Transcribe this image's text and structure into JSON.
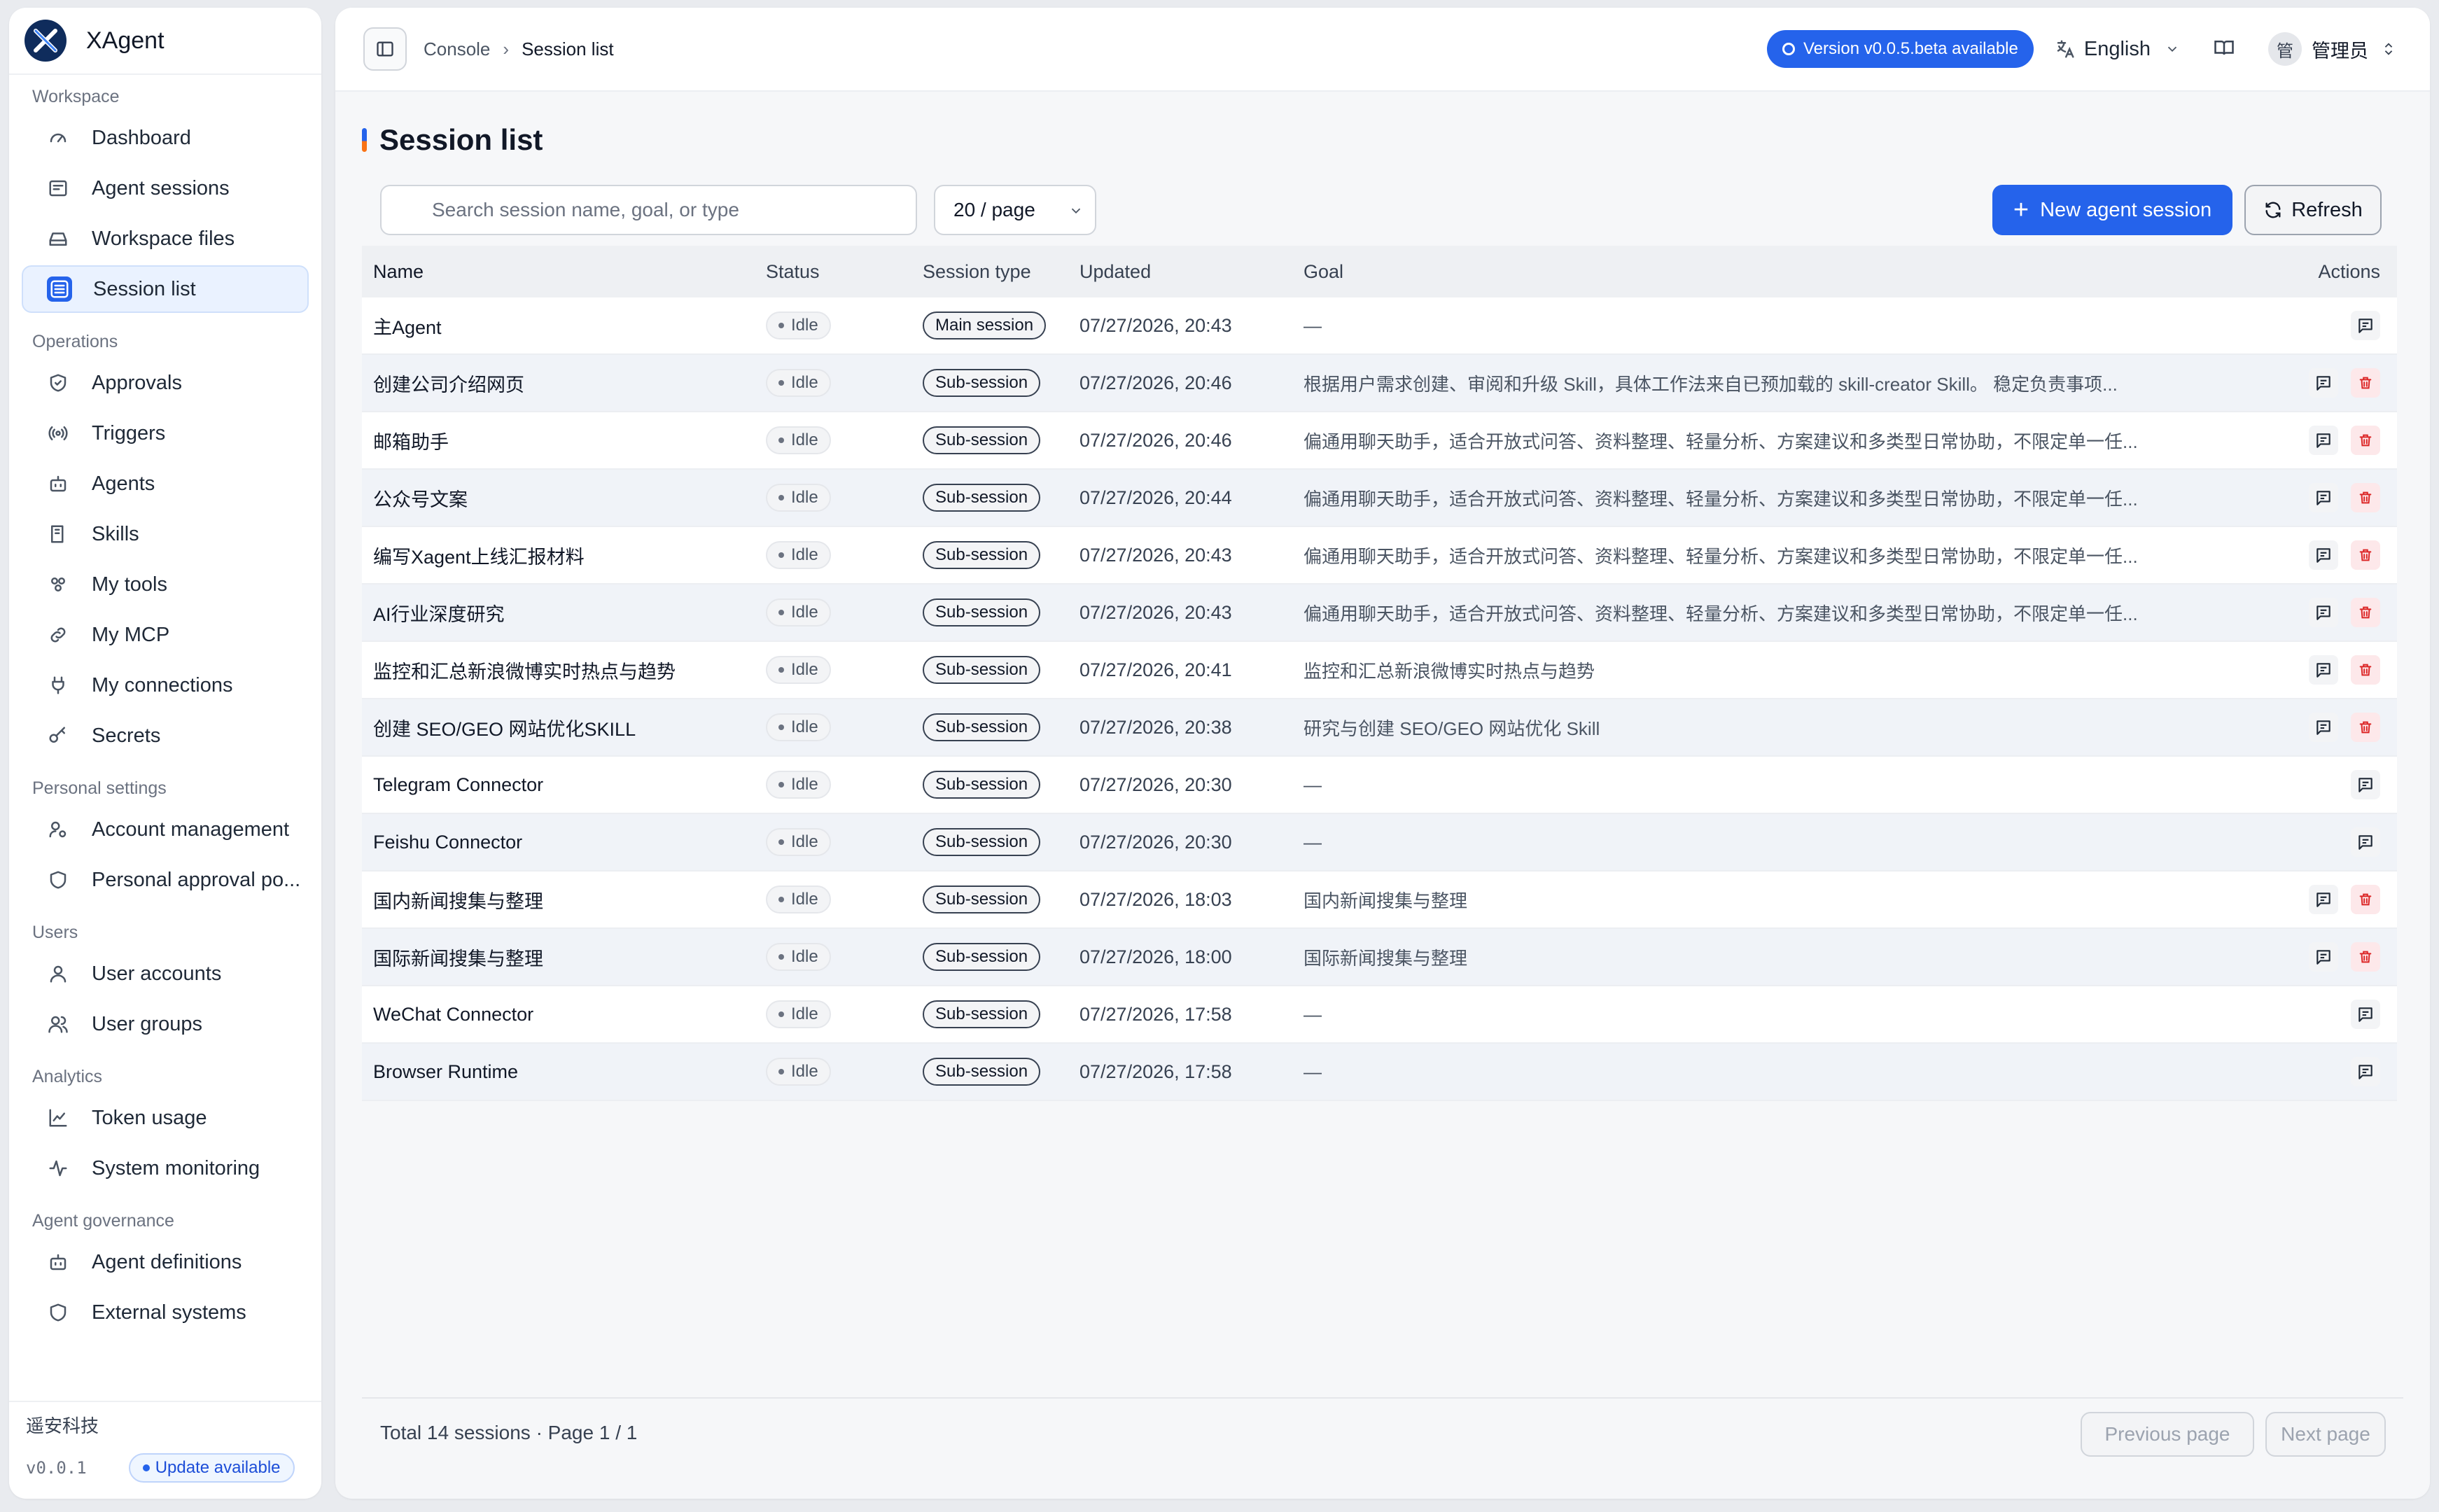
{
  "brand": {
    "name": "XAgent"
  },
  "sidebar": {
    "groups": [
      {
        "label": "Workspace",
        "items": [
          {
            "label": "Dashboard",
            "icon": "gauge-icon"
          },
          {
            "label": "Agent sessions",
            "icon": "message-square-icon"
          },
          {
            "label": "Workspace files",
            "icon": "hard-drive-icon"
          },
          {
            "label": "Session list",
            "icon": "list-icon",
            "active": true
          }
        ]
      },
      {
        "label": "Operations",
        "items": [
          {
            "label": "Approvals",
            "icon": "shield-check-icon"
          },
          {
            "label": "Triggers",
            "icon": "radio-icon"
          },
          {
            "label": "Agents",
            "icon": "bot-icon"
          },
          {
            "label": "Skills",
            "icon": "book-icon"
          },
          {
            "label": "My tools",
            "icon": "blocks-icon"
          },
          {
            "label": "My MCP",
            "icon": "link-icon"
          },
          {
            "label": "My connections",
            "icon": "plug-icon"
          },
          {
            "label": "Secrets",
            "icon": "key-icon"
          }
        ]
      },
      {
        "label": "Personal settings",
        "items": [
          {
            "label": "Account management",
            "icon": "user-cog-icon"
          },
          {
            "label": "Personal approval po...",
            "icon": "shield-icon"
          }
        ]
      },
      {
        "label": "Users",
        "items": [
          {
            "label": "User accounts",
            "icon": "user-icon"
          },
          {
            "label": "User groups",
            "icon": "users-icon"
          }
        ]
      },
      {
        "label": "Analytics",
        "items": [
          {
            "label": "Token usage",
            "icon": "line-chart-icon"
          },
          {
            "label": "System monitoring",
            "icon": "activity-icon"
          }
        ]
      },
      {
        "label": "Agent governance",
        "items": [
          {
            "label": "Agent definitions",
            "icon": "bot-icon"
          },
          {
            "label": "External systems",
            "icon": "shield-icon"
          }
        ]
      }
    ],
    "footer": {
      "org": "遥安科技",
      "version": "v0.0.1",
      "update_label": "Update available"
    }
  },
  "topbar": {
    "breadcrumb": [
      "Console",
      "Session list"
    ],
    "version_label": "Version v0.0.5.beta available",
    "language": "English",
    "avatar_text": "管",
    "user_name": "管理员"
  },
  "page": {
    "title": "Session list",
    "search_placeholder": "Search session name, goal, or type",
    "page_size": "20 / page",
    "new_button": "New agent session",
    "refresh_button": "Refresh"
  },
  "table": {
    "columns": [
      "Name",
      "Status",
      "Session type",
      "Updated",
      "Goal",
      "Actions"
    ],
    "rows": [
      {
        "name": "主Agent",
        "status": "Idle",
        "type": "Main session",
        "updated": "07/27/2026, 20:43",
        "goal": "—",
        "deletable": false
      },
      {
        "name": "创建公司介绍网页",
        "status": "Idle",
        "type": "Sub-session",
        "updated": "07/27/2026, 20:46",
        "goal": "根据用户需求创建、审阅和升级 Skill，具体工作法来自已预加载的 skill-creator Skill。 稳定负责事项...",
        "deletable": true
      },
      {
        "name": "邮箱助手",
        "status": "Idle",
        "type": "Sub-session",
        "updated": "07/27/2026, 20:46",
        "goal": "偏通用聊天助手，适合开放式问答、资料整理、轻量分析、方案建议和多类型日常协助，不限定单一任...",
        "deletable": true
      },
      {
        "name": "公众号文案",
        "status": "Idle",
        "type": "Sub-session",
        "updated": "07/27/2026, 20:44",
        "goal": "偏通用聊天助手，适合开放式问答、资料整理、轻量分析、方案建议和多类型日常协助，不限定单一任...",
        "deletable": true
      },
      {
        "name": "编写Xagent上线汇报材料",
        "status": "Idle",
        "type": "Sub-session",
        "updated": "07/27/2026, 20:43",
        "goal": "偏通用聊天助手，适合开放式问答、资料整理、轻量分析、方案建议和多类型日常协助，不限定单一任...",
        "deletable": true
      },
      {
        "name": "AI行业深度研究",
        "status": "Idle",
        "type": "Sub-session",
        "updated": "07/27/2026, 20:43",
        "goal": "偏通用聊天助手，适合开放式问答、资料整理、轻量分析、方案建议和多类型日常协助，不限定单一任...",
        "deletable": true
      },
      {
        "name": "监控和汇总新浪微博实时热点与趋势",
        "status": "Idle",
        "type": "Sub-session",
        "updated": "07/27/2026, 20:41",
        "goal": "监控和汇总新浪微博实时热点与趋势",
        "deletable": true
      },
      {
        "name": "创建 SEO/GEO 网站优化SKILL",
        "status": "Idle",
        "type": "Sub-session",
        "updated": "07/27/2026, 20:38",
        "goal": "研究与创建 SEO/GEO 网站优化 Skill",
        "deletable": true
      },
      {
        "name": "Telegram Connector",
        "status": "Idle",
        "type": "Sub-session",
        "updated": "07/27/2026, 20:30",
        "goal": "—",
        "deletable": false
      },
      {
        "name": "Feishu Connector",
        "status": "Idle",
        "type": "Sub-session",
        "updated": "07/27/2026, 20:30",
        "goal": "—",
        "deletable": false
      },
      {
        "name": "国内新闻搜集与整理",
        "status": "Idle",
        "type": "Sub-session",
        "updated": "07/27/2026, 18:03",
        "goal": "国内新闻搜集与整理",
        "deletable": true
      },
      {
        "name": "国际新闻搜集与整理",
        "status": "Idle",
        "type": "Sub-session",
        "updated": "07/27/2026, 18:00",
        "goal": "国际新闻搜集与整理",
        "deletable": true
      },
      {
        "name": "WeChat Connector",
        "status": "Idle",
        "type": "Sub-session",
        "updated": "07/27/2026, 17:58",
        "goal": "—",
        "deletable": false
      },
      {
        "name": "Browser Runtime",
        "status": "Idle",
        "type": "Sub-session",
        "updated": "07/27/2026, 17:58",
        "goal": "—",
        "deletable": false
      }
    ]
  },
  "pagination": {
    "total_text": "Total 14 sessions · Page 1 / 1",
    "prev_label": "Previous page",
    "next_label": "Next page"
  },
  "colors": {
    "accent": "#2563eb",
    "danger": "#dc2626"
  }
}
